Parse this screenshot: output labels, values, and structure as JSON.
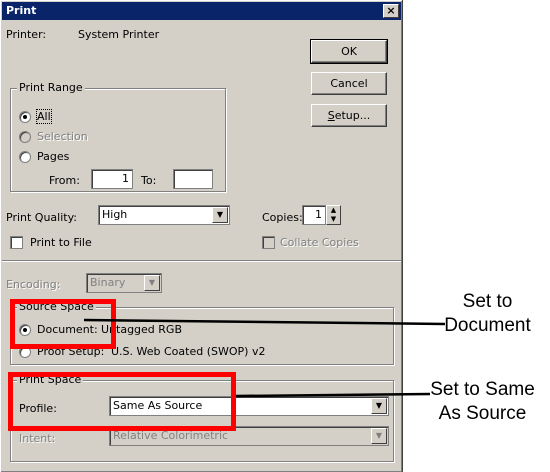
{
  "window": {
    "title": "Print",
    "close_glyph": "×"
  },
  "printer": {
    "label": "Printer:",
    "value": "System Printer"
  },
  "buttons": {
    "ok": "OK",
    "cancel": "Cancel",
    "setup": "Setup..."
  },
  "print_range": {
    "legend": "Print Range",
    "all": "All",
    "selection": "Selection",
    "pages": "Pages",
    "from_label": "From:",
    "from_value": "1",
    "to_label": "To:",
    "to_value": ""
  },
  "print_quality": {
    "label": "Print Quality:",
    "value": "High"
  },
  "copies": {
    "label": "Copies:",
    "value": "1"
  },
  "print_to_file": {
    "label": "Print to File",
    "checked": false
  },
  "collate": {
    "label": "Collate Copies",
    "checked": false
  },
  "encoding": {
    "label": "Encoding:",
    "value": "Binary"
  },
  "source_space": {
    "legend": "Source Space",
    "document_label": "Document:",
    "document_value": "Untagged RGB",
    "proof_label": "Proof Setup:",
    "proof_value": "U.S. Web Coated (SWOP) v2"
  },
  "print_space": {
    "legend": "Print Space",
    "profile_label": "Profile:",
    "profile_value": "Same As Source",
    "intent_label": "Intent:",
    "intent_value": "Relative Colorimetric"
  },
  "annotations": {
    "callout1_line1": "Set to",
    "callout1_line2": "Document",
    "callout2_line1": "Set to Same",
    "callout2_line2": "As Source",
    "highlight_color": "#ff0000"
  }
}
